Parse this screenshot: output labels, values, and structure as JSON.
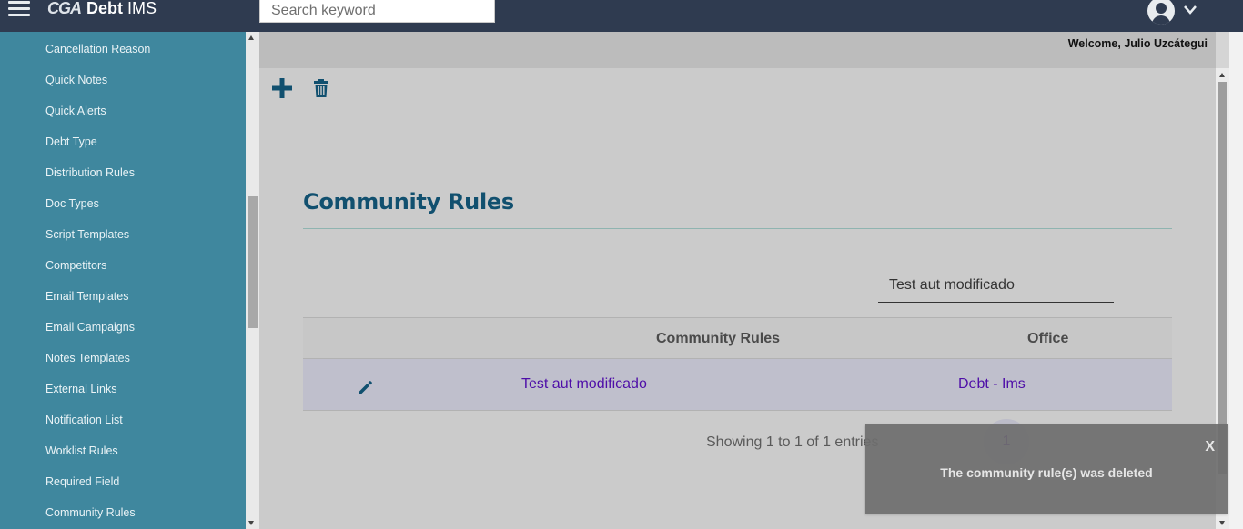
{
  "header": {
    "logo_text": "CGA",
    "app_name_bold": "Debt",
    "app_name_rest": " IMS",
    "search_placeholder": "Search keyword"
  },
  "sidebar": {
    "items": [
      "Cancellation Reason",
      "Quick Notes",
      "Quick Alerts",
      "Debt Type",
      "Distribution Rules",
      "Doc Types",
      "Script Templates",
      "Competitors",
      "Email Templates",
      "Email Campaigns",
      "Notes Templates",
      "External Links",
      "Notification List",
      "Worklist Rules",
      "Required Field",
      "Community Rules"
    ]
  },
  "welcome": "Welcome, Julio Uzcátegui",
  "main": {
    "title": "Community Rules",
    "filter_value": "Test aut modificado",
    "table": {
      "columns": [
        "Community Rules",
        "Office"
      ],
      "rows": [
        {
          "rule": "Test aut modificado",
          "office": "Debt - Ims"
        }
      ]
    },
    "entries_info": "Showing 1 to 1 of 1 entries",
    "current_page": "1"
  },
  "toast": {
    "close_label": "X",
    "message": "The community rule(s) was deleted"
  },
  "colors": {
    "topbar": "#2f3b50",
    "sidebar": "#3f879e",
    "title": "#11506f",
    "link": "#4e0ea8"
  }
}
